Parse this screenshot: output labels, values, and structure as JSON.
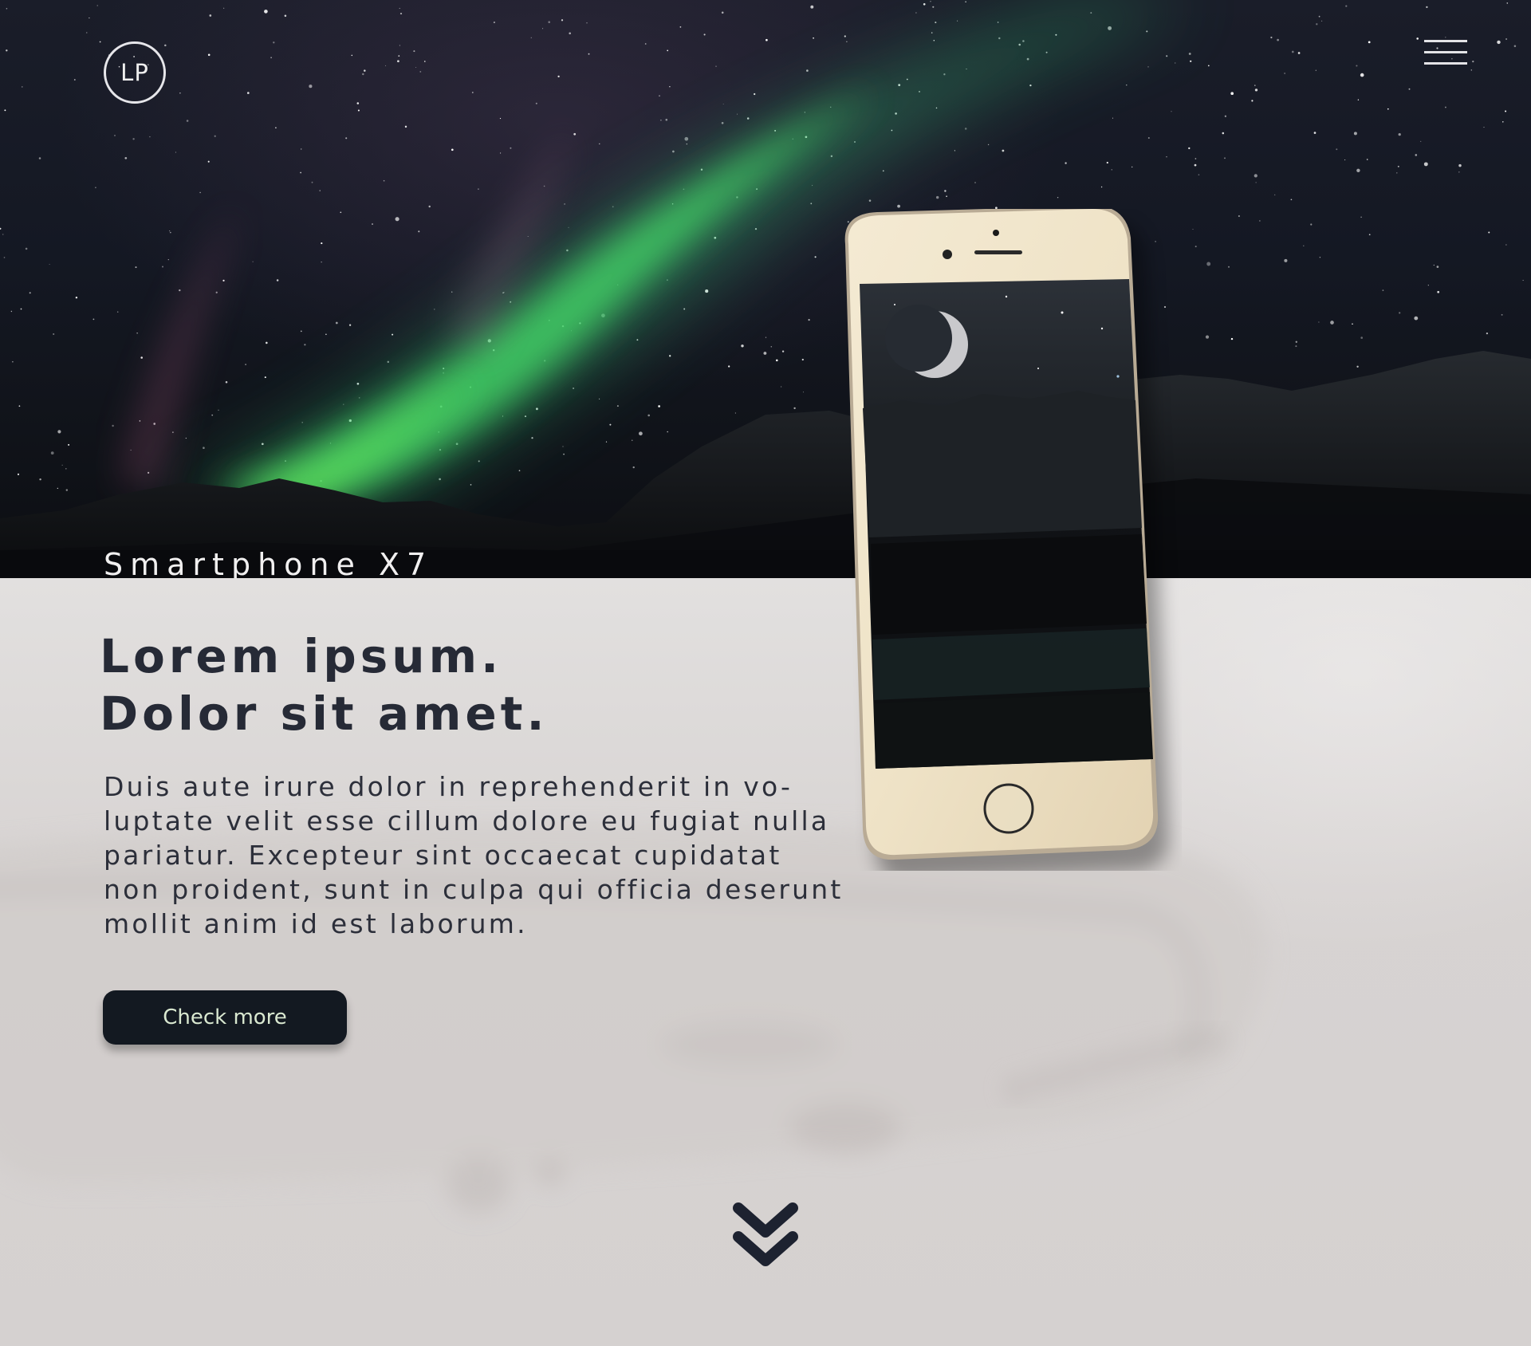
{
  "header": {
    "logo_text": "LP",
    "menu_icon": "hamburger-menu-icon"
  },
  "hero": {
    "product_name": "Smartphone X7"
  },
  "main": {
    "headline_line1": "Lorem ipsum.",
    "headline_line2": "Dolor sit amet.",
    "body_lines": [
      "Duis aute irure dolor in reprehenderit in vo-",
      "luptate velit esse cillum dolore eu fugiat nulla",
      "pariatur. Excepteur sint occaecat cupidatat",
      "non proident, sunt in culpa qui officia deserunt",
      "mollit anim id est laborum."
    ],
    "cta_label": "Check more",
    "scroll_icon": "double-chevron-down-icon"
  },
  "colors": {
    "sky": "#141823",
    "aurora": "#3fd46a",
    "content_bg": "#d9d6d5",
    "text_dark": "#262a36",
    "button_bg": "#131921",
    "button_text": "#d9e8d0",
    "phone_body": "#efe4c9"
  }
}
